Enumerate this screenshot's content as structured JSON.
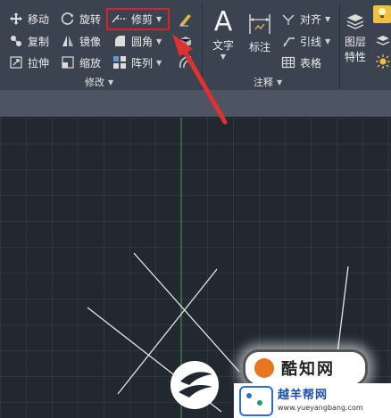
{
  "modify": {
    "group_label": "修改",
    "move": "移动",
    "rotate": "旋转",
    "trim": "修剪",
    "copy": "复制",
    "mirror": "镜像",
    "fillet": "圆角",
    "stretch": "拉伸",
    "scale": "缩放",
    "array": "阵列"
  },
  "annotation": {
    "group_label": "注释",
    "text": "文字",
    "dimension": "标注",
    "align": "对齐",
    "leader": "引线",
    "table": "表格"
  },
  "layers": {
    "line1": "图层",
    "line2": "特性"
  },
  "watermark": {
    "badge_text": "酷知网",
    "site_name": "越羊帮网",
    "site_url": "www.yueyangbang.com"
  },
  "colors": {
    "highlight": "#e02020",
    "arrow": "#e03030",
    "ribbon": "#3c4350",
    "canvas": "#212830",
    "y_axis": "#3a8a3a"
  }
}
